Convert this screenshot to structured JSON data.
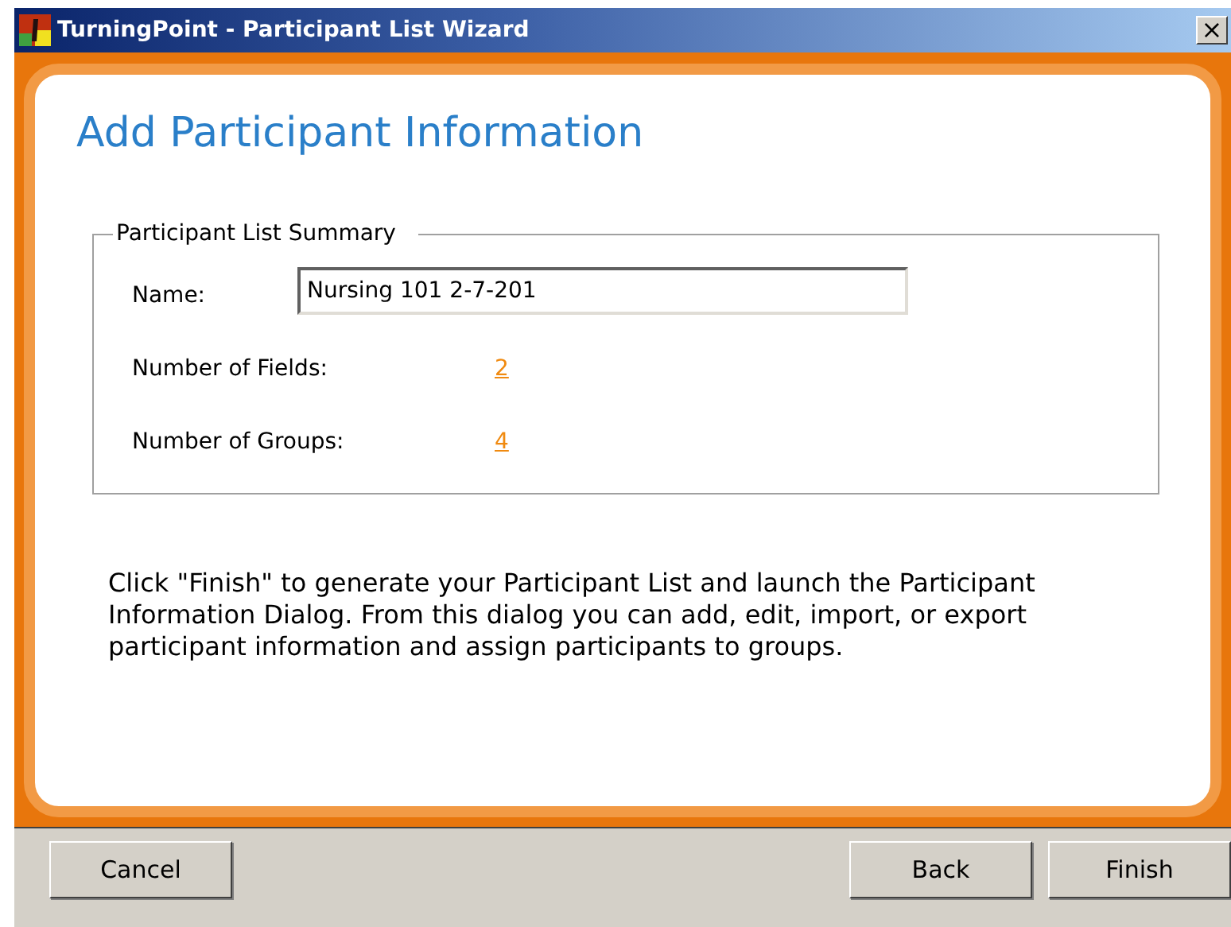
{
  "window": {
    "title": "TurningPoint - Participant List Wizard",
    "close": "×"
  },
  "heading": "Add Participant Information",
  "summary": {
    "legend": "Participant List Summary",
    "name_label": "Name:",
    "name_value": "Nursing 101 2-7-201",
    "rows": [
      {
        "label": "Number of Fields:",
        "value": "2"
      },
      {
        "label": "Number of Groups:",
        "value": "4"
      }
    ]
  },
  "description": "Click \"Finish\" to generate your Participant List and launch the Participant Information Dialog.  From this dialog you can add, edit, import, or export participant information and assign participants to groups.",
  "buttons": {
    "left": [
      "Cancel"
    ],
    "right": [
      "Back",
      "Finish"
    ]
  }
}
